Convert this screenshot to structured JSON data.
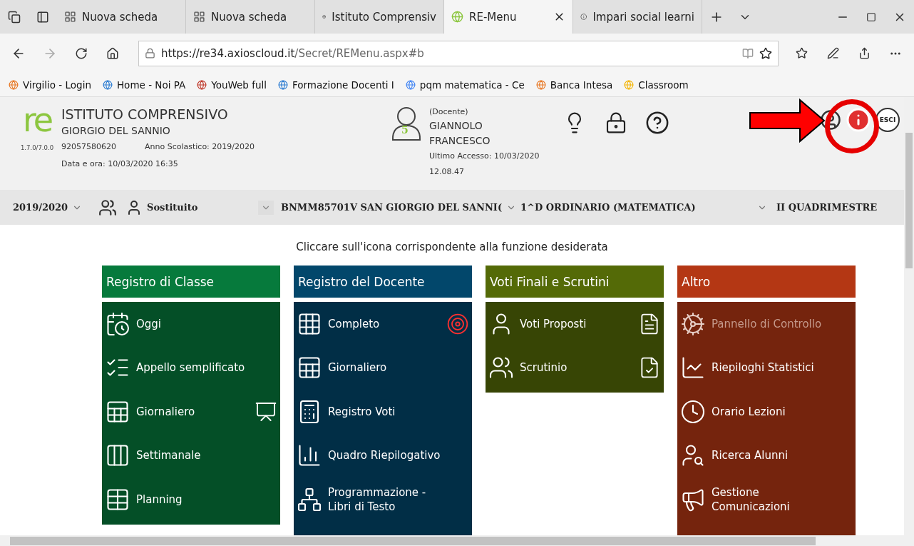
{
  "browser": {
    "tabs": [
      {
        "title": "Nuova scheda",
        "selected": false
      },
      {
        "title": "Nuova scheda",
        "selected": false
      },
      {
        "title": "Istituto Comprensiv",
        "selected": false
      },
      {
        "title": "RE-Menu",
        "selected": true
      },
      {
        "title": "Impari social learni",
        "selected": false
      }
    ],
    "url": {
      "host": "https://re34.axioscloud.it",
      "path": "/Secret/REMenu.aspx#b"
    },
    "bookmarks": [
      "Virgilio - Login",
      "Home - Noi PA",
      "YouWeb full",
      "Formazione Docenti I",
      "pqm matematica - Ce",
      "Banca Intesa",
      "Classroom"
    ]
  },
  "header": {
    "logo": "re",
    "version": "1.7.0/7.0.0",
    "school_line1": "ISTITUTO COMPRENSIVO",
    "school_line2": "GIORGIO DEL SANNIO",
    "code": "92057580620",
    "school_year": "Anno Scolastico: 2019/2020",
    "datetime": "Data e ora: 10/03/2020 16:35",
    "user": {
      "badge": "5",
      "role": "(Docente)",
      "name": "GIANNOLO FRANCESCO",
      "last_access": "Ultimo Accesso: 10/03/2020 12.08.47"
    },
    "logout": "ESCI"
  },
  "selectors": [
    "2019/2020",
    "Sostituito",
    "BNMM85701V SAN GIORGIO DEL SANNI(",
    "1^D ORDINARIO (MATEMATICA)",
    "II QUADRIMESTRE"
  ],
  "instruction": "Cliccare sull'icona corrispondente alla funzione desiderata",
  "columns": [
    {
      "title": "Registro di Classe",
      "color": "#067a3c",
      "items": [
        {
          "label": "Oggi",
          "disabled": false
        },
        {
          "label": "Appello semplificato",
          "disabled": false
        },
        {
          "label": "Giornaliero",
          "disabled": false
        },
        {
          "label": "Settimanale",
          "disabled": false
        },
        {
          "label": "Planning",
          "disabled": false
        }
      ]
    },
    {
      "title": "Registro del Docente",
      "color": "#02476b",
      "items": [
        {
          "label": "Completo",
          "disabled": false
        },
        {
          "label": "Giornaliero",
          "disabled": false
        },
        {
          "label": "Registro Voti",
          "disabled": false
        },
        {
          "label": "Quadro Riepilogativo",
          "disabled": false
        },
        {
          "label": "Programmazione - Libri di Testo",
          "disabled": false
        }
      ]
    },
    {
      "title": "Voti Finali e Scrutini",
      "color": "#546a07",
      "items": [
        {
          "label": "Voti Proposti",
          "disabled": false
        },
        {
          "label": "Scrutinio",
          "disabled": false
        }
      ]
    },
    {
      "title": "Altro",
      "color": "#b43714",
      "items": [
        {
          "label": "Pannello di Controllo",
          "disabled": true
        },
        {
          "label": "Riepiloghi Statistici",
          "disabled": false
        },
        {
          "label": "Orario Lezioni",
          "disabled": false
        },
        {
          "label": "Ricerca Alunni",
          "disabled": false
        },
        {
          "label": "Gestione Comunicazioni",
          "disabled": false
        }
      ]
    }
  ]
}
